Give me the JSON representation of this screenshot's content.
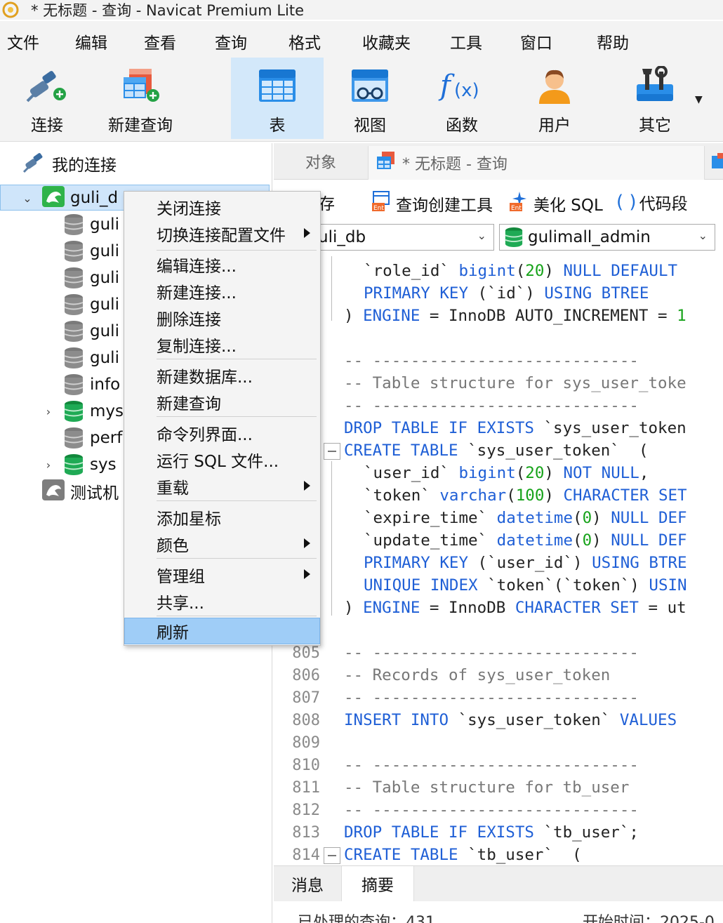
{
  "window": {
    "title": "* 无标题 - 查询 - Navicat Premium Lite"
  },
  "menubar": {
    "items": [
      "文件",
      "编辑",
      "查看",
      "查询",
      "格式",
      "收藏夹",
      "工具",
      "窗口",
      "帮助"
    ]
  },
  "toolbar": {
    "connect": "连接",
    "new_query": "新建查询",
    "table": "表",
    "view": "视图",
    "function": "函数",
    "user": "用户",
    "other": "其它"
  },
  "navigator": {
    "root": "我的连接",
    "connection": "guli_d",
    "databases": [
      "guli",
      "guli",
      "guli",
      "guli",
      "guli",
      "guli",
      "info",
      "mys",
      "perf",
      "sys"
    ],
    "other_connection": "测试机"
  },
  "tabs": {
    "object": "对象",
    "query": "* 无标题 - 查询"
  },
  "query_toolbar": {
    "save": "保存",
    "save_visible": "存",
    "builder": "查询创建工具",
    "beautify": "美化 SQL",
    "snippet": "代码段"
  },
  "selectors": {
    "database": "uli_db",
    "schema": "gulimall_admin"
  },
  "editor": {
    "line_numbers": [
      "805",
      "806",
      "807",
      "808",
      "809",
      "810",
      "811",
      "812",
      "813",
      "814"
    ]
  },
  "bottom": {
    "tab_messages": "消息",
    "tab_summary": "摘要",
    "summary_left": "已处理的查询：431",
    "summary_right": "开始时间：2025-0"
  },
  "context_menu": {
    "items": [
      "关闭连接",
      "切换连接配置文件",
      "编辑连接...",
      "新建连接...",
      "删除连接",
      "复制连接...",
      "新建数据库...",
      "新建查询",
      "命令列界面...",
      "运行 SQL 文件...",
      "重载",
      "添加星标",
      "颜色",
      "管理组",
      "共享...",
      "刷新"
    ]
  },
  "colors": {
    "keyword": "#1f5fd6",
    "number": "#17a31a",
    "comment": "#777777",
    "selection": "#9fcdf7",
    "db_green": "#1faa55"
  }
}
